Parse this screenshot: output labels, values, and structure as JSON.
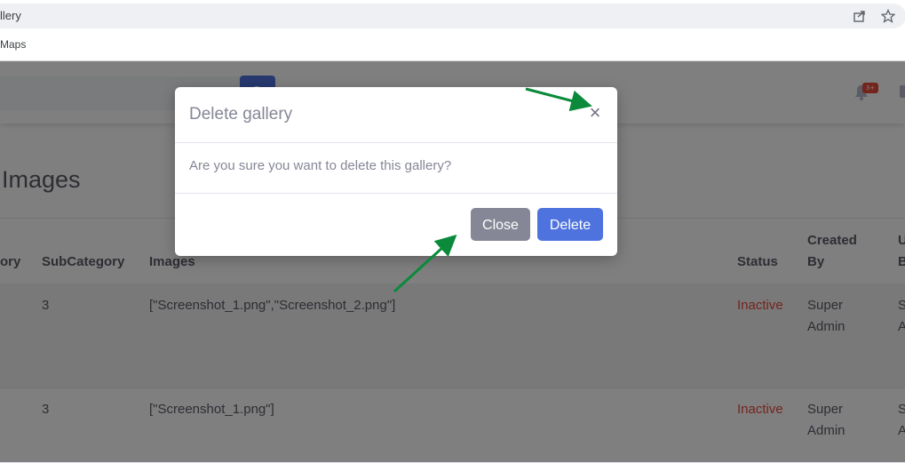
{
  "browser": {
    "url": "llery",
    "bookmark": "Maps"
  },
  "header": {
    "notification_count": "3+"
  },
  "page": {
    "title": "Images"
  },
  "table": {
    "headers": {
      "category": "ory",
      "subcategory": "SubCategory",
      "images": "Images",
      "status": "Status",
      "created_by_1": "Created",
      "created_by_2": "By",
      "updated_by_1": "U",
      "updated_by_2": "B"
    },
    "rows": [
      {
        "subcategory": "3",
        "images": "[\"Screenshot_1.png\",\"Screenshot_2.png\"]",
        "status": "Inactive",
        "created_by_1": "Super",
        "created_by_2": "Admin",
        "updated_by_1": "S",
        "updated_by_2": "A"
      },
      {
        "subcategory": "3",
        "images": "[\"Screenshot_1.png\"]",
        "status": "Inactive",
        "created_by_1": "Super",
        "created_by_2": "Admin",
        "updated_by_1": "S",
        "updated_by_2": "A"
      }
    ]
  },
  "modal": {
    "title": "Delete gallery",
    "close_symbol": "×",
    "message": "Are you sure you want to delete this gallery?",
    "close_label": "Close",
    "delete_label": "Delete"
  },
  "colors": {
    "primary": "#4e73df",
    "secondary": "#858796",
    "danger": "#e74a3b",
    "annotation_arrow": "#0a8a3a"
  },
  "icons": [
    "share-icon",
    "star-icon",
    "search-icon",
    "bell-icon",
    "mail-icon",
    "close-icon"
  ]
}
